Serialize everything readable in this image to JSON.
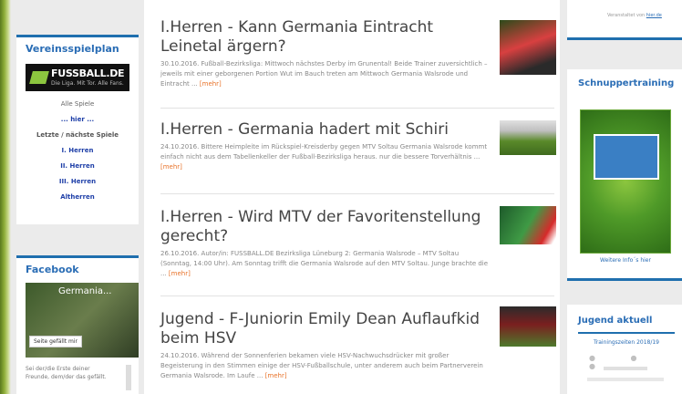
{
  "left_sidebar": {
    "vereinsspielplan": {
      "title": "Vereinsspielplan",
      "logo_text": "FUSSBALL.DE",
      "logo_subtext": "Die Liga. Mit Tor. Alle Fans.",
      "links": [
        "Alle Spiele",
        "... hier ...",
        "Letzte / nächste Spiele",
        "I. Herren",
        "II. Herren",
        "III. Herren",
        "Altherren"
      ]
    },
    "facebook": {
      "title": "Facebook",
      "page_name": "Germania...",
      "like_button": "Seite gefällt mir",
      "body_text": "Sei der/die Erste deiner Freunde, dem/der das gefällt."
    }
  },
  "articles": [
    {
      "title": "I.Herren - Kann Germania Eintracht Leinetal ärgern?",
      "excerpt": "30.10.2016. Fußball-Bezirksliga: Mittwoch nächstes Derby im Grunental! Beide Trainer zuversichtlich – jeweils mit einer geborgenen Portion Wut im Bauch treten am Mittwoch Germania Walsrode und Eintracht ...",
      "more": "[mehr]"
    },
    {
      "title": "I.Herren - Germania hadert mit Schiri",
      "excerpt": "24.10.2016. Bittere Heimpleite im Rückspiel-Kreisderby gegen MTV Soltau Germania Walsrode kommt einfach nicht aus dem Tabellenkeller der Fußball-Bezirksliga heraus. nur die bessere Torverhältnis ...",
      "more": "[mehr]"
    },
    {
      "title": "I.Herren - Wird MTV der Favoritenstellung gerecht?",
      "excerpt": "26.10.2016. Autor/in: FUSSBALL.DE Bezirksliga Lüneburg 2: Germania Walsrode – MTV Soltau (Sonntag, 14:00 Uhr). Am Sonntag trifft die Germania Walsrode auf den MTV Soltau. Junge brachte die ...",
      "more": "[mehr]"
    },
    {
      "title": "Jugend - F-Juniorin Emily Dean Auflaufkid beim HSV",
      "excerpt": "24.10.2016. Während der Sonnenferien bekamen viele HSV-Nachwuchsdrücker mit großer Begeisterung in den Stimmen einige der HSV-Fußballschule, unter anderem auch beim Partnerverein Germania Walsrode. Im Laufe ...",
      "more": "[mehr]"
    }
  ],
  "right_sidebar": {
    "top_text_prefix": "Veranstaltet von",
    "top_text_link": "hier.de",
    "schnupper": {
      "title": "Schnuppertraining",
      "more_link": "Weitere Info´s hier"
    },
    "jugend": {
      "title": "Jugend aktuell",
      "subtitle": "Trainingszeiten 2018/19"
    }
  },
  "colors": {
    "accent_blue": "#1f6fae",
    "link_blue": "#1e3fa8",
    "more_orange": "#e8732a"
  }
}
